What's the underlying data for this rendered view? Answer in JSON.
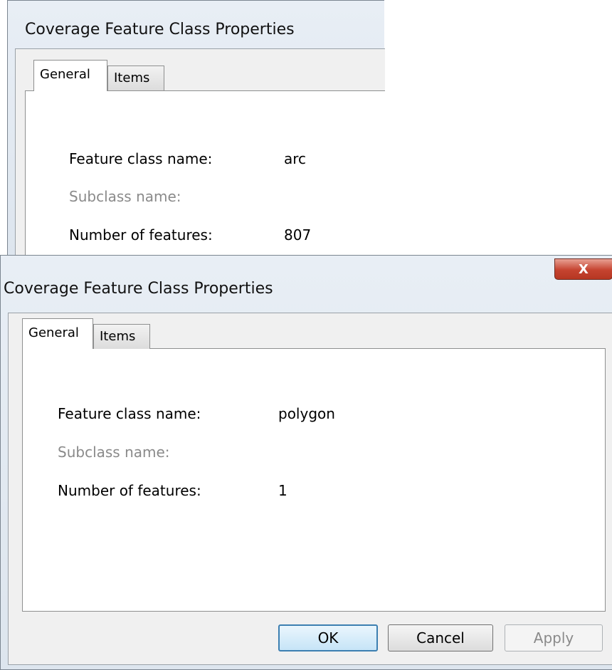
{
  "dialog_back": {
    "title": "Coverage Feature Class Properties",
    "tabs": [
      {
        "label": "General",
        "active": true
      },
      {
        "label": "Items",
        "active": false
      }
    ],
    "rows": [
      {
        "label": "Feature class name:",
        "value": "arc",
        "muted": false
      },
      {
        "label": "Subclass name:",
        "value": "",
        "muted": true
      },
      {
        "label": "Number of features:",
        "value": "807",
        "muted": false
      }
    ]
  },
  "dialog_front": {
    "title": "Coverage Feature Class Properties",
    "close_label": "X",
    "tabs": [
      {
        "label": "General",
        "active": true
      },
      {
        "label": "Items",
        "active": false
      }
    ],
    "rows": [
      {
        "label": "Feature class name:",
        "value": "polygon",
        "muted": false
      },
      {
        "label": "Subclass name:",
        "value": "",
        "muted": true
      },
      {
        "label": "Number of features:",
        "value": "1",
        "muted": false
      }
    ],
    "buttons": {
      "ok": "OK",
      "cancel": "Cancel",
      "apply": "Apply"
    }
  },
  "colors": {
    "close_red": "#c5432f",
    "default_button_border": "#3c7fb1",
    "disabled_text": "#8a8a8a"
  }
}
